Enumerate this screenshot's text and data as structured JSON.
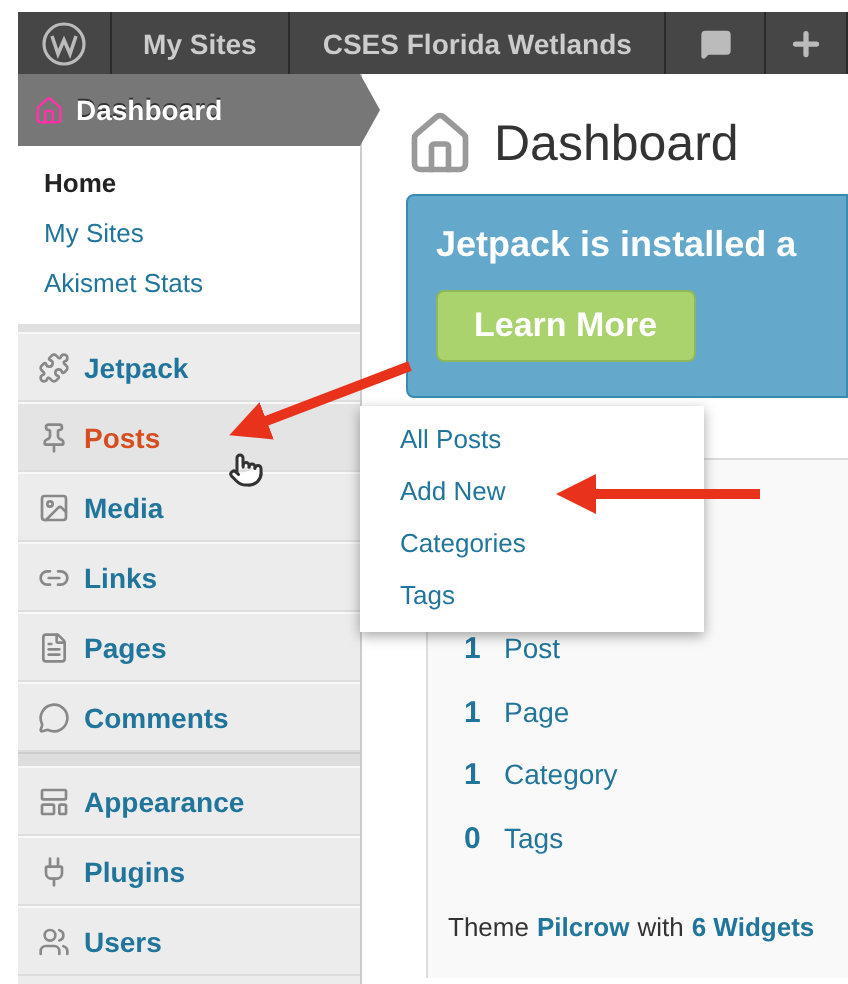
{
  "admin_bar": {
    "items": [
      "My Sites",
      "CSES Florida Wetlands"
    ]
  },
  "sidebar": {
    "header": {
      "label": "Dashboard",
      "selected": true
    },
    "submenu": [
      {
        "label": "Home",
        "selected": true
      },
      {
        "label": "My Sites",
        "selected": false
      },
      {
        "label": "Akismet Stats",
        "selected": false
      }
    ],
    "items": [
      {
        "kind": "item",
        "label": "Jetpack",
        "selected": false
      },
      {
        "kind": "item",
        "label": "Posts",
        "selected": true
      },
      {
        "kind": "item",
        "label": "Media",
        "selected": false
      },
      {
        "kind": "item",
        "label": "Links",
        "selected": false
      },
      {
        "kind": "item",
        "label": "Pages",
        "selected": false
      },
      {
        "kind": "item",
        "label": "Comments",
        "selected": false
      },
      {
        "kind": "separator"
      },
      {
        "kind": "item",
        "label": "Appearance",
        "selected": false
      },
      {
        "kind": "item",
        "label": "Plugins",
        "selected": false
      },
      {
        "kind": "item",
        "label": "Users",
        "selected": false
      }
    ]
  },
  "flyout": {
    "items": [
      "All Posts",
      "Add New",
      "Categories",
      "Tags"
    ]
  },
  "page_title": "Dashboard",
  "notice": {
    "text": "Jetpack is installed a",
    "button": "Learn More"
  },
  "right_now": {
    "counts": [
      {
        "count": "1",
        "label": "Post"
      },
      {
        "count": "1",
        "label": "Page"
      },
      {
        "count": "1",
        "label": "Category"
      },
      {
        "count": "0",
        "label": "Tags"
      }
    ],
    "theme_line": {
      "prefix": "Theme",
      "theme": "Pilcrow",
      "middle": "with",
      "widgets": "6 Widgets"
    }
  }
}
